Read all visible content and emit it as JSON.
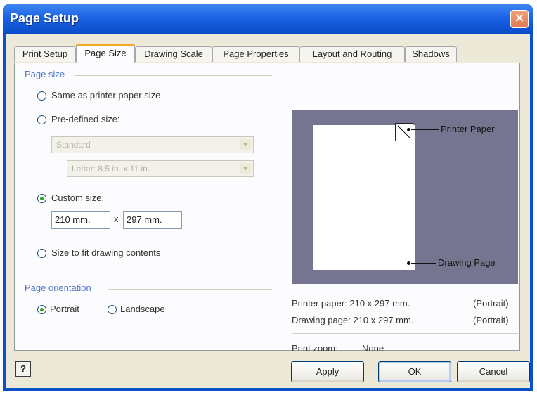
{
  "window": {
    "title": "Page Setup"
  },
  "tabs": [
    {
      "label": "Print Setup"
    },
    {
      "label": "Page Size"
    },
    {
      "label": "Drawing Scale"
    },
    {
      "label": "Page Properties"
    },
    {
      "label": "Layout and Routing"
    },
    {
      "label": "Shadows"
    }
  ],
  "active_tab": "Page Size",
  "page_size": {
    "group_label": "Page size",
    "option_same": "Same as printer paper size",
    "option_predefined": "Pre-defined size:",
    "predefined_type": "Standard",
    "predefined_size": "Letter: 8.5 in. x 11 in.",
    "option_custom": "Custom size:",
    "custom_width": "210 mm.",
    "times": "x",
    "custom_height": "297 mm.",
    "option_fit": "Size to fit drawing contents",
    "selected": "Custom size:"
  },
  "orientation": {
    "group_label": "Page orientation",
    "portrait": "Portrait",
    "landscape": "Landscape",
    "selected": "Portrait"
  },
  "preview": {
    "printer_paper_label": "Printer Paper",
    "drawing_page_label": "Drawing Page"
  },
  "info": {
    "printer_paper": "Printer paper:  210 x 297 mm.",
    "printer_paper_orientation": "(Portrait)",
    "drawing_page": "Drawing page:  210 x 297 mm.",
    "drawing_page_orientation": "(Portrait)",
    "print_zoom_label": "Print zoom:",
    "print_zoom_value": "None"
  },
  "buttons": {
    "help": "?",
    "apply": "Apply",
    "ok": "OK",
    "cancel": "Cancel"
  },
  "colors": {
    "title_bar": "#0b4fcb",
    "dialog_bg": "#ece9d8",
    "active_tab_accent": "#f5a623",
    "preview_bg": "#75758f",
    "group_label": "#5077cf"
  },
  "icons": {
    "close": "close-icon",
    "help": "help-icon"
  }
}
